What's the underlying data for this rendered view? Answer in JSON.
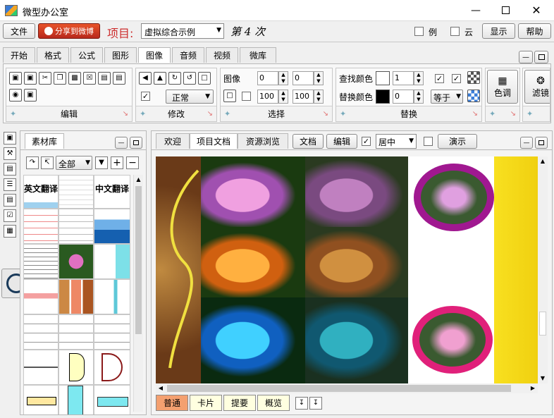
{
  "app": {
    "title": "微型办公室",
    "accent": "#cc2b2b"
  },
  "window": {
    "minimize_icon": "minimize-icon",
    "maximize_icon": "maximize-icon",
    "close_icon": "close-icon"
  },
  "menubar": {
    "file": "文件",
    "share": "分享到微博",
    "project_label": "项目:",
    "project_value": "虚拟综合示例",
    "lesson": "第 4 次",
    "opt_example": "例",
    "opt_cloud": "云",
    "show": "显示",
    "help": "帮助"
  },
  "ribbon_tabs": [
    "开始",
    "格式",
    "公式",
    "图形",
    "图像",
    "音频",
    "视频",
    "微库"
  ],
  "ribbon": {
    "edit_label": "编辑",
    "modify_label": "修改",
    "modify_mode": "正常",
    "select_label": "选择",
    "image_label": "图像",
    "x": "0",
    "y": "0",
    "w": "100",
    "h": "100",
    "find_label": "查找颜色",
    "replace_label": "替换颜色",
    "find_val": "1",
    "replace_val": "0",
    "equal": "等于",
    "replace_group": "替换",
    "tone": "色调",
    "filter": "滤镜"
  },
  "library": {
    "title": "素材库",
    "filter": "全部",
    "thumb_en": "英文翻译",
    "thumb_zh": "中文翻译"
  },
  "doc": {
    "tabs": [
      "欢迎",
      "项目文档",
      "资源浏览"
    ],
    "doc_btn": "文档",
    "edit_btn": "编辑",
    "align": "居中",
    "present": "演示"
  },
  "bottom_tabs": [
    "普通",
    "卡片",
    "提要",
    "概览"
  ],
  "colors": {
    "find": "#ffffff",
    "replace": "#000000"
  }
}
